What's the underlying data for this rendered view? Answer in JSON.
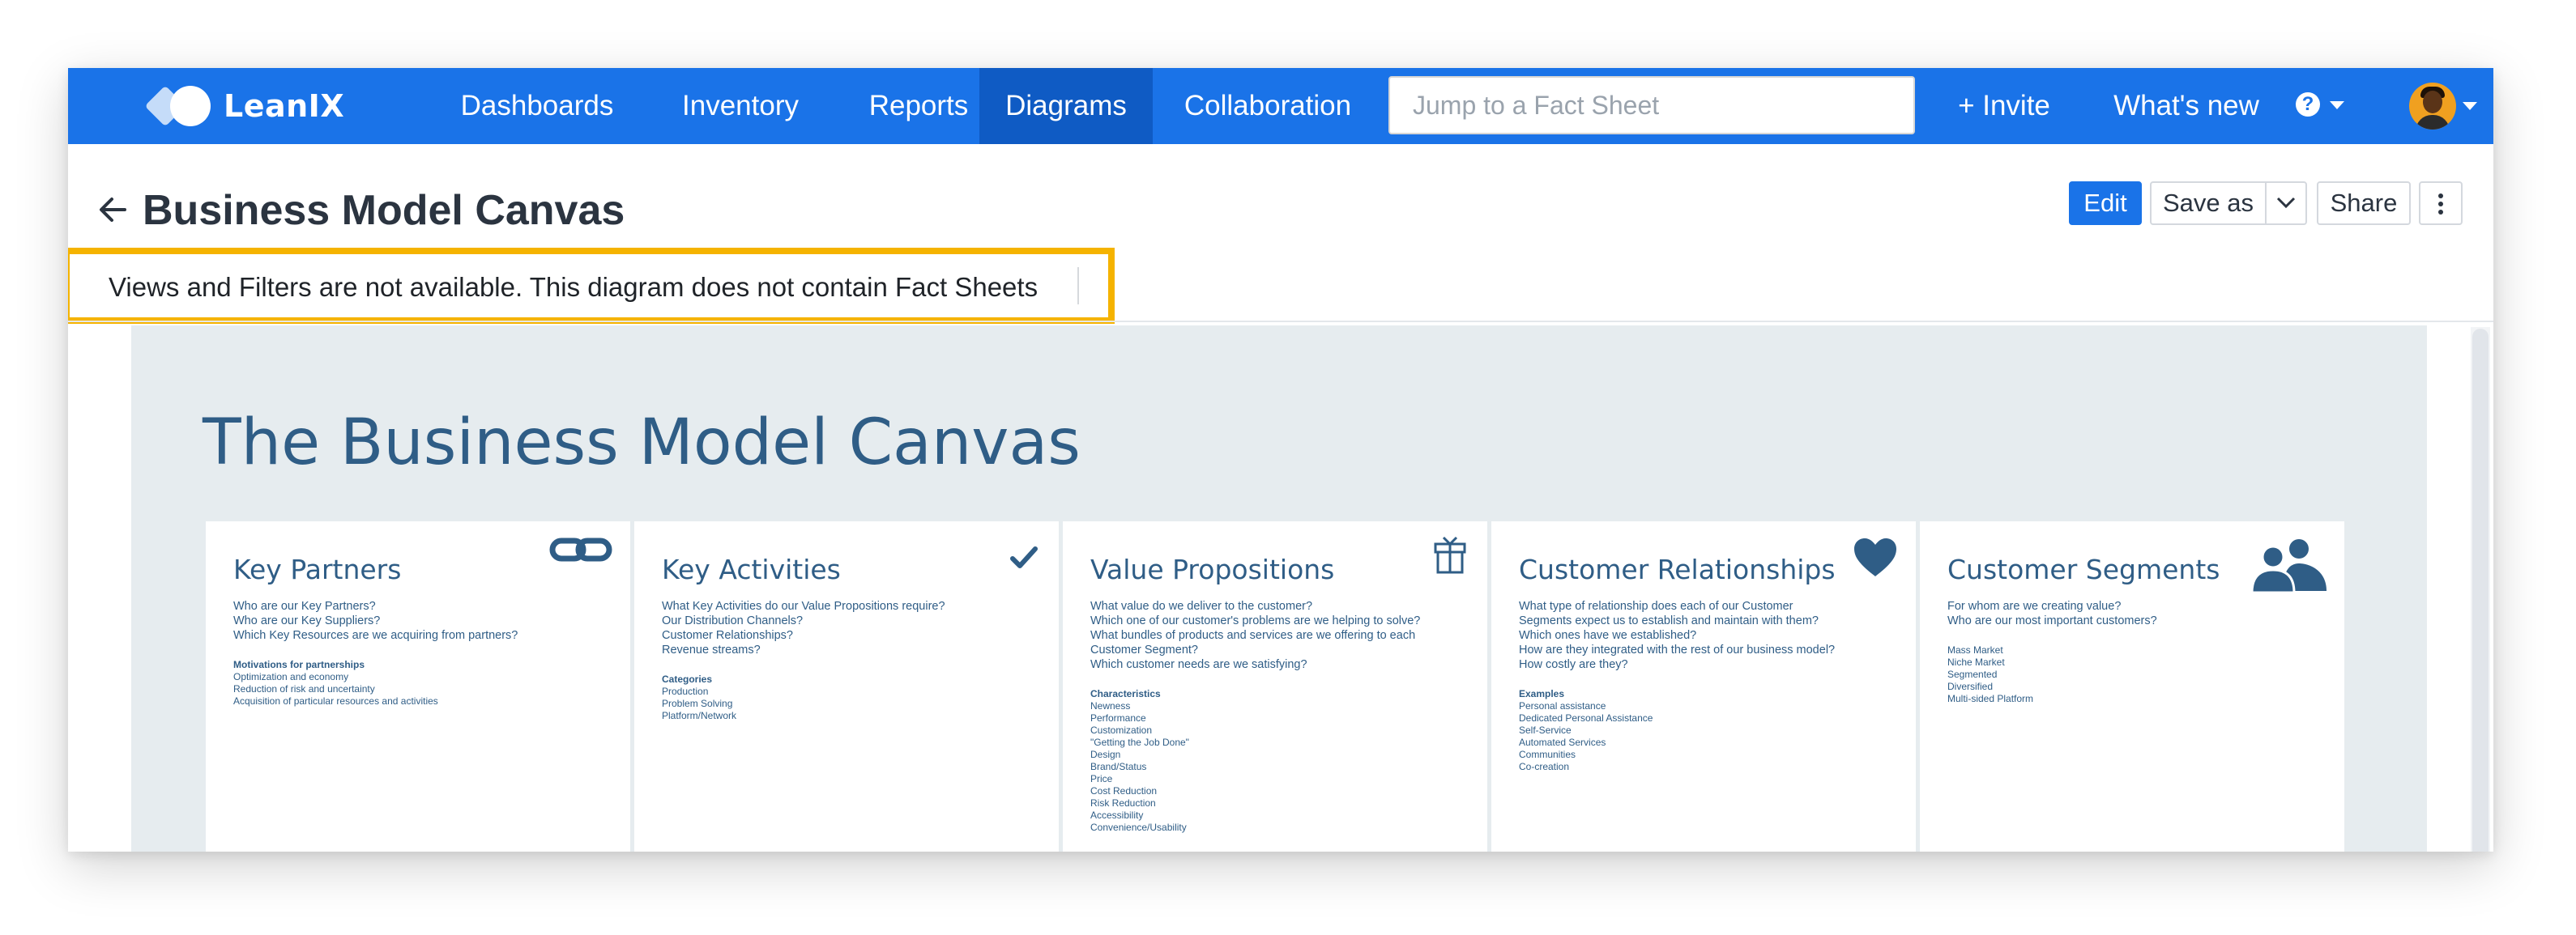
{
  "brand": {
    "name": "LeanIX"
  },
  "nav": {
    "items": [
      {
        "label": "Dashboards"
      },
      {
        "label": "Inventory"
      },
      {
        "label": "Reports"
      },
      {
        "label": "Diagrams"
      },
      {
        "label": "Collaboration"
      }
    ],
    "active": "Diagrams",
    "search_placeholder": "Jump to a Fact Sheet",
    "invite_label": "+ Invite",
    "whats_new_label": "What's new",
    "help_symbol": "?"
  },
  "header": {
    "title": "Business Model Canvas",
    "edit_label": "Edit",
    "save_as_label": "Save as",
    "share_label": "Share"
  },
  "notice": {
    "text": "Views and Filters are not available. This diagram does not contain Fact Sheets"
  },
  "colors": {
    "nav_bg": "#1a73e8",
    "nav_active": "#0f5bc4",
    "highlight": "#f5b300",
    "canvas_bg": "#e6ecef",
    "canvas_text": "#2f5d86"
  },
  "canvas": {
    "title": "The Business Model Canvas",
    "cards": [
      {
        "title": "Key Partners",
        "icon": "link-icon",
        "questions": [
          "Who are our Key Partners?",
          "Who are our Key Suppliers?",
          "Which Key Resources are we acquiring from partners?"
        ],
        "sub_heading": "Motivations for partnerships",
        "sub_items": [
          "Optimization and economy",
          "Reduction of risk and uncertainty",
          "Acquisition of particular resources and activities"
        ]
      },
      {
        "title": "Key Activities",
        "icon": "checkmark-icon",
        "questions": [
          "What Key Activities do our Value Propositions require?",
          "Our Distribution Channels?",
          "Customer Relationships?",
          "Revenue streams?"
        ],
        "sub_heading": "Categories",
        "sub_items": [
          "Production",
          "Problem Solving",
          "Platform/Network"
        ]
      },
      {
        "title": "Value Propositions",
        "icon": "gift-icon",
        "questions": [
          "What value do we deliver to the customer?",
          "Which one of our customer's problems are we helping to solve?",
          "What bundles of products and services are we offering to each",
          "Customer Segment?",
          "Which customer needs are we satisfying?"
        ],
        "sub_heading": "Characteristics",
        "sub_items": [
          "Newness",
          "Performance",
          "Customization",
          "\"Getting the Job Done\"",
          "Design",
          "Brand/Status",
          "Price",
          "Cost Reduction",
          "Risk Reduction",
          "Accessibility",
          "Convenience/Usability"
        ]
      },
      {
        "title": "Customer Relationships",
        "icon": "heart-icon",
        "questions": [
          "What type of relationship does each of our Customer",
          "Segments expect us to establish and maintain with them?",
          "Which ones have we established?",
          "How are they integrated with the rest of our business model?",
          "How costly are they?"
        ],
        "sub_heading": "Examples",
        "sub_items": [
          "Personal assistance",
          "Dedicated Personal Assistance",
          "Self-Service",
          "Automated Services",
          "Communities",
          "Co-creation"
        ]
      },
      {
        "title": "Customer Segments",
        "icon": "users-icon",
        "questions": [
          "For whom are we creating value?",
          "Who are our most important customers?"
        ],
        "sub_heading": "",
        "sub_items": [
          "Mass Market",
          "Niche Market",
          "Segmented",
          "Diversified",
          "Multi-sided Platform"
        ]
      }
    ]
  }
}
